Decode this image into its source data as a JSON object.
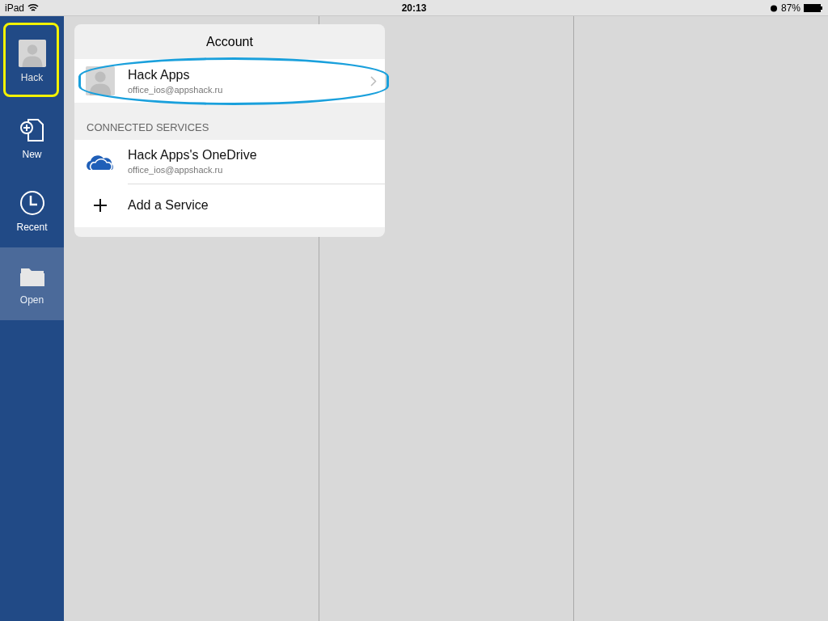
{
  "status_bar": {
    "device": "iPad",
    "time": "20:13",
    "battery": "87%"
  },
  "sidebar": {
    "items": [
      {
        "kind": "account",
        "label": "Hack",
        "selected": false
      },
      {
        "kind": "new",
        "label": "New",
        "selected": false
      },
      {
        "kind": "recent",
        "label": "Recent",
        "selected": false
      },
      {
        "kind": "open",
        "label": "Open",
        "selected": true
      }
    ]
  },
  "popover": {
    "title": "Account",
    "account": {
      "name": "Hack Apps",
      "email": "office_ios@appshack.ru"
    },
    "section_header": "CONNECTED SERVICES",
    "services": [
      {
        "kind": "onedrive",
        "name": "Hack Apps's OneDrive",
        "email": "office_ios@appshack.ru"
      },
      {
        "kind": "add",
        "name": "Add a Service"
      }
    ]
  }
}
